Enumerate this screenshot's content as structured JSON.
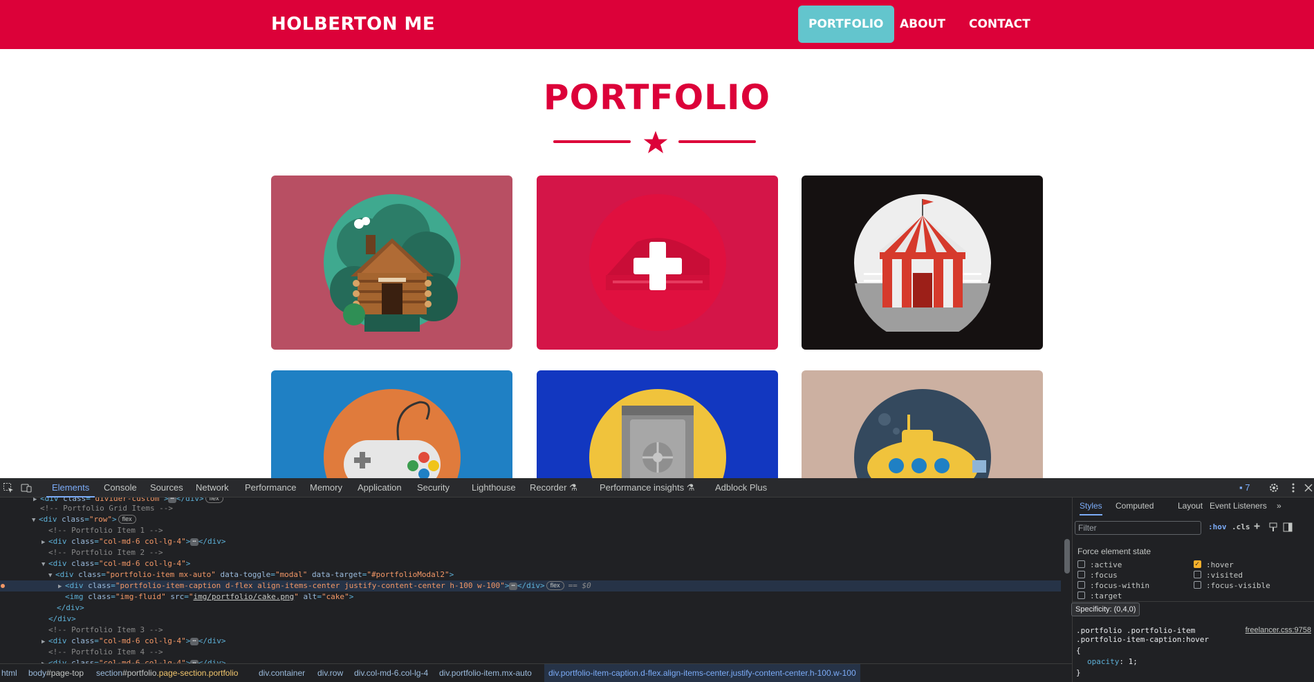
{
  "site": {
    "brand": "HOLBERTON ME",
    "nav": [
      {
        "label": "PORTFOLIO",
        "active": true
      },
      {
        "label": "ABOUT",
        "active": false
      },
      {
        "label": "CONTACT",
        "active": false
      }
    ],
    "section_title": "PORTFOLIO",
    "tiles": [
      {
        "name": "cabin",
        "bg": "#b84f63"
      },
      {
        "name": "cake",
        "bg": "#d41548"
      },
      {
        "name": "circus",
        "bg": "#151111"
      },
      {
        "name": "game",
        "bg": "#1f80c4"
      },
      {
        "name": "safe",
        "bg": "#1237c0"
      },
      {
        "name": "submarine",
        "bg": "#ccb0a1"
      }
    ],
    "colors": {
      "primary": "#dc0139",
      "active_nav": "#63c5cd"
    }
  },
  "devtools": {
    "tabs": [
      "Elements",
      "Console",
      "Sources",
      "Network",
      "Performance",
      "Memory",
      "Application",
      "Security",
      "Lighthouse",
      "Recorder",
      "Performance insights",
      "Adblock Plus"
    ],
    "issues_count": "7",
    "dom": {
      "l0_cls": "divider-custom",
      "l0_pill": "flex",
      "c_grid": "<!-- Portfolio Grid Items -->",
      "row_cls": "row",
      "row_pill": "flex",
      "c_item1": "<!-- Portfolio Item 1 -->",
      "col_cls": "col-md-6 col-lg-4",
      "c_item2": "<!-- Portfolio Item 2 -->",
      "item_cls": "portfolio-item mx-auto",
      "toggle_val": "modal",
      "target_val": "#portfolioModal2",
      "caption_cls": "portfolio-item-caption d-flex align-items-center justify-content-center h-100 w-100",
      "caption_pill": "flex",
      "eq": "== $0",
      "img_cls": "img-fluid",
      "img_src": "img/portfolio/cake.png",
      "img_alt": "cake",
      "c_item3": "<!-- Portfolio Item 3 -->",
      "c_item4": "<!-- Portfolio Item 4 -->",
      "ellipsis": "⋯"
    },
    "breadcrumb": {
      "html": "html",
      "body_tag": "body",
      "body_id": "#page-top",
      "section_tag": "section",
      "section_id": "#portfolio",
      "section_cls": ".page-section.portfolio",
      "container": "div.container",
      "row": "div.row",
      "col": "div.col-md-6.col-lg-4",
      "item": "div.portfolio-item.mx-auto",
      "caption": "div.portfolio-item-caption.d-flex.align-items-center.justify-content-center.h-100.w-100"
    },
    "styles": {
      "tabs": [
        "Styles",
        "Computed",
        "Layout",
        "Event Listeners"
      ],
      "filter_placeholder": "Filter",
      "hov": ":hov",
      "cls": ".cls",
      "force_title": "Force element state",
      "states_left": [
        ":active",
        ":focus",
        ":focus-within",
        ":target"
      ],
      "states_right": [
        ":hover",
        ":visited",
        ":focus-visible"
      ],
      "hover_checked": true,
      "tooltip": "Specificity: (0,4,0)",
      "selector_line1": ".portfolio .portfolio-item",
      "selector_line2": ".portfolio-item-caption:hover",
      "source": "freelancer.css:9758",
      "open_brace": "{",
      "prop": "opacity",
      "prop_value": "1;",
      "close_brace": "}"
    }
  }
}
